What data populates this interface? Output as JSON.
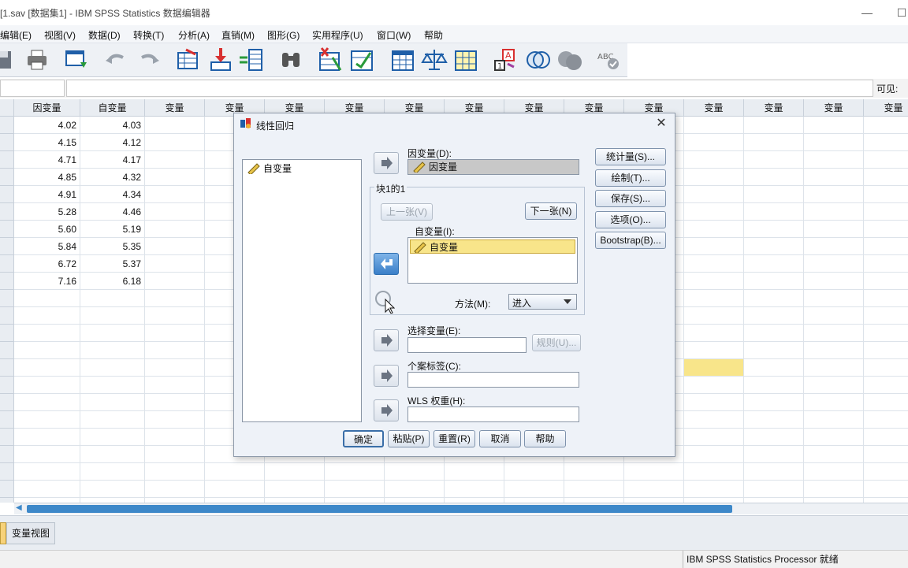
{
  "window": {
    "title": "[1.sav [数据集1] - IBM SPSS Statistics 数据编辑器",
    "minimize": "—",
    "maximize": "☐"
  },
  "menu": [
    "编辑(E)",
    "视图(V)",
    "数据(D)",
    "转换(T)",
    "分析(A)",
    "直销(M)",
    "图形(G)",
    "实用程序(U)",
    "窗口(W)",
    "帮助"
  ],
  "toolbar_icons": [
    "save-icon",
    "print-icon",
    "dialog-recall-icon",
    "undo-icon",
    "redo-icon",
    "goto-case-icon",
    "goto-variable-icon",
    "variables-icon",
    "find-icon",
    "insert-cases-icon",
    "insert-variable-icon",
    "split-file-icon",
    "weight-cases-icon",
    "select-cases-icon",
    "value-labels-icon",
    "use-sets-icon",
    "show-all-icon",
    "spell-check-icon"
  ],
  "cell_editor": {
    "visible_label": "可见:"
  },
  "grid": {
    "columns": [
      "因变量",
      "自变量",
      "变量",
      "变量",
      "变量",
      "变量",
      "变量",
      "变量",
      "变量",
      "变量",
      "变量",
      "变量",
      "变量",
      "变量",
      "变量"
    ],
    "rows": [
      [
        "4.02",
        "4.03"
      ],
      [
        "4.15",
        "4.12"
      ],
      [
        "4.71",
        "4.17"
      ],
      [
        "4.85",
        "4.32"
      ],
      [
        "4.91",
        "4.34"
      ],
      [
        "5.28",
        "4.46"
      ],
      [
        "5.60",
        "5.19"
      ],
      [
        "5.84",
        "5.35"
      ],
      [
        "6.72",
        "5.37"
      ],
      [
        "7.16",
        "6.18"
      ]
    ]
  },
  "tabs": {
    "variable_view": "变量视图"
  },
  "status": {
    "processor": "IBM SPSS Statistics Processor 就绪"
  },
  "dialog": {
    "title": "线性回归",
    "close": "✕",
    "source_list": [
      "自变量"
    ],
    "dependent_label": "因变量(D):",
    "dependent_value": "因变量",
    "block_label": "块1的1",
    "prev_button": "上一张(V)",
    "next_button": "下一张(N)",
    "independent_label": "自变量(I):",
    "independent_value": "自变量",
    "method_label": "方法(M):",
    "method_value": "进入",
    "selection_label": "选择变量(E):",
    "rule_button": "规则(U)...",
    "case_label": "个案标签(C):",
    "wls_label": "WLS 权重(H):",
    "side_buttons": [
      "统计量(S)...",
      "绘制(T)...",
      "保存(S)...",
      "选项(O)...",
      "Bootstrap(B)..."
    ],
    "bottom_buttons": [
      "确定",
      "粘贴(P)",
      "重置(R)",
      "取消",
      "帮助"
    ]
  }
}
